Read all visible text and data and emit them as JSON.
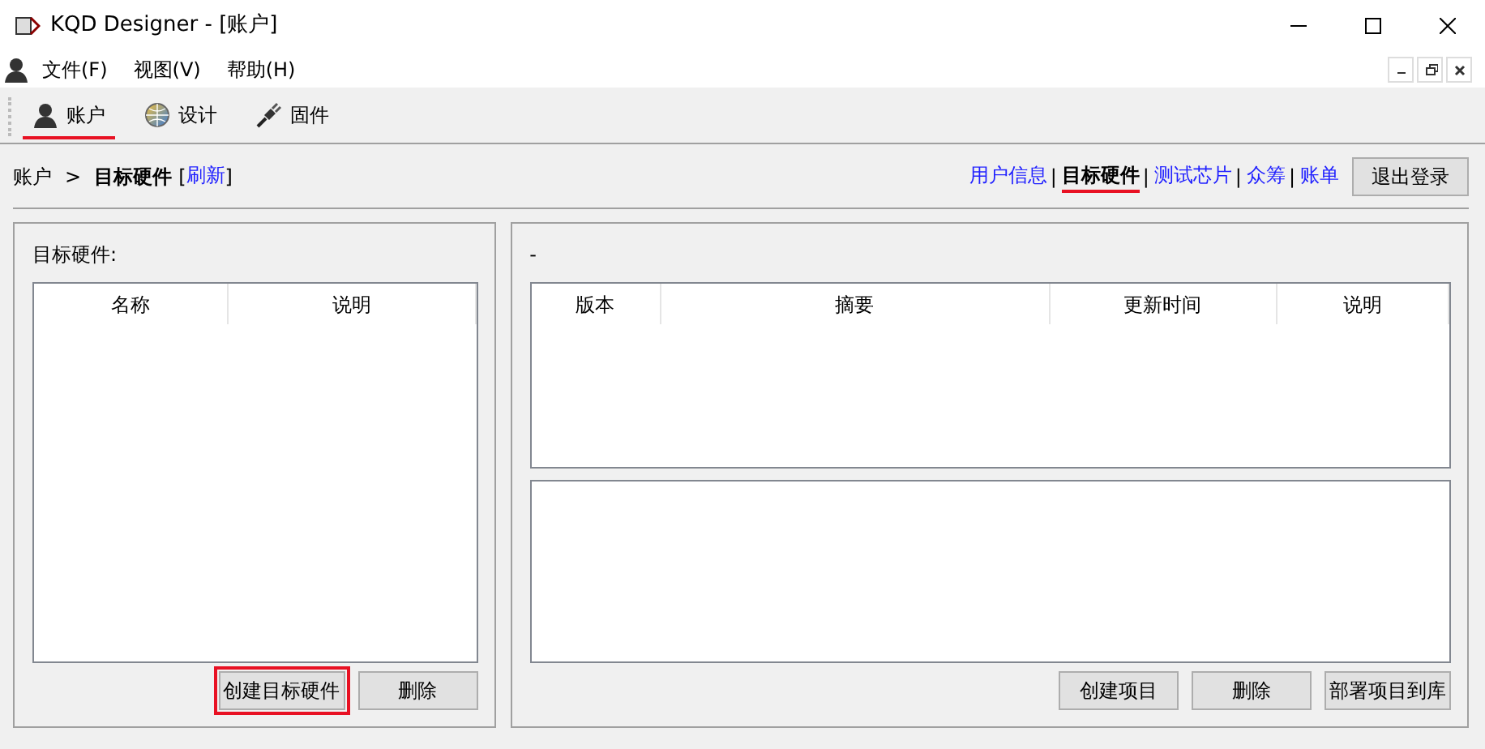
{
  "window": {
    "title": "KQD Designer - [账户]"
  },
  "menu": [
    {
      "label": "文件(F)"
    },
    {
      "label": "视图(V)"
    },
    {
      "label": "帮助(H)"
    }
  ],
  "toolbar_tabs": [
    {
      "label": "账户",
      "kind": "person",
      "selected": true
    },
    {
      "label": "设计",
      "kind": "globe",
      "selected": false
    },
    {
      "label": "固件",
      "kind": "plug",
      "selected": false
    }
  ],
  "breadcrumb": {
    "root": "账户",
    "separator": ">",
    "current": "目标硬件",
    "open_bracket": "[",
    "refresh": "刷新",
    "close_bracket": "]"
  },
  "nav_links": [
    {
      "label": "用户信息",
      "selected": false,
      "separator": "|"
    },
    {
      "label": "目标硬件",
      "selected": true,
      "separator": "|"
    },
    {
      "label": "测试芯片",
      "selected": false,
      "separator": "|"
    },
    {
      "label": "众筹",
      "selected": false,
      "separator": "|"
    },
    {
      "label": "账单",
      "selected": false
    }
  ],
  "logout_button": "退出登录",
  "left_panel": {
    "label": "目标硬件:",
    "columns": [
      "名称",
      "说明"
    ],
    "buttons": [
      {
        "label": "创建目标硬件",
        "highlighted": true
      },
      {
        "label": "删除",
        "highlighted": false
      }
    ]
  },
  "right_panel": {
    "label": "-",
    "columns": [
      "版本",
      "摘要",
      "更新时间",
      "说明"
    ],
    "buttons": [
      {
        "label": "创建项目",
        "highlighted": false
      },
      {
        "label": "删除",
        "highlighted": false
      },
      {
        "label": "部署项目到库",
        "highlighted": false
      }
    ]
  }
}
